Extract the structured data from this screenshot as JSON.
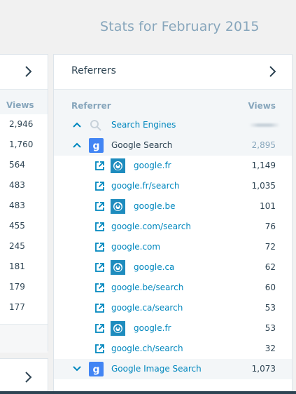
{
  "page_title": "Stats for February 2015",
  "left_card": {
    "column_header": "Views",
    "values": [
      "2,946",
      "1,760",
      "564",
      "483",
      "483",
      "455",
      "245",
      "181",
      "179",
      "177"
    ]
  },
  "referrers": {
    "title": "Referrers",
    "column_label": "Referrer",
    "column_value": "Views",
    "search_engines": {
      "label": "Search Engines",
      "expanded": true
    },
    "google_search": {
      "label": "Google Search",
      "views": "2,895",
      "expanded": true
    },
    "items": [
      {
        "label": "google.fr",
        "views": "1,149",
        "icon": "gravatar"
      },
      {
        "label": "google.fr/search",
        "views": "1,035",
        "icon": "none"
      },
      {
        "label": "google.be",
        "views": "101",
        "icon": "gravatar"
      },
      {
        "label": "google.com/search",
        "views": "76",
        "icon": "none"
      },
      {
        "label": "google.com",
        "views": "72",
        "icon": "none"
      },
      {
        "label": "google.ca",
        "views": "62",
        "icon": "gravatar"
      },
      {
        "label": "google.be/search",
        "views": "60",
        "icon": "none"
      },
      {
        "label": "google.ca/search",
        "views": "53",
        "icon": "none"
      },
      {
        "label": "google.fr",
        "views": "53",
        "icon": "gravatar"
      },
      {
        "label": "google.ch/search",
        "views": "32",
        "icon": "none"
      }
    ],
    "google_image_search": {
      "label": "Google Image Search",
      "views": "1,073",
      "expanded": false
    }
  },
  "colors": {
    "link": "#0087be",
    "text": "#2e4453",
    "muted": "#87a6bc",
    "google": "#4285f4"
  }
}
